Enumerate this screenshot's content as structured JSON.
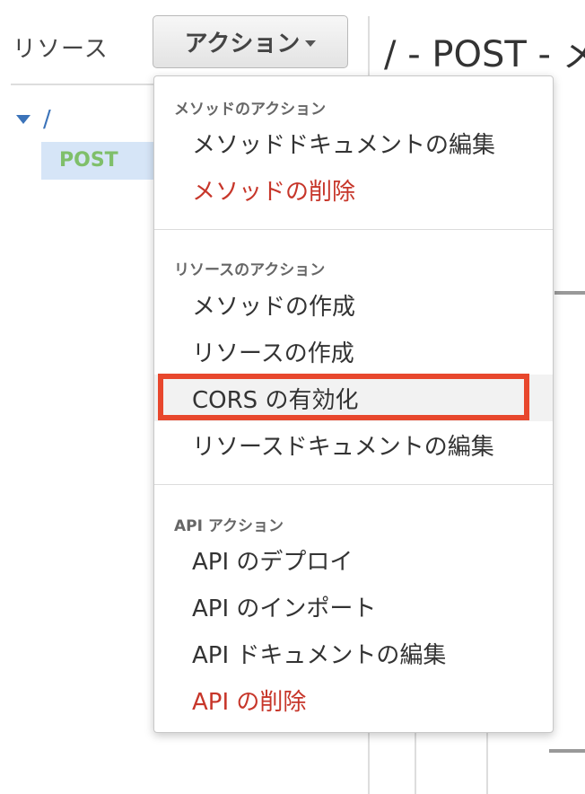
{
  "resources_panel": {
    "title": "リソース",
    "tree": {
      "root_label": "/",
      "method_label": "POST"
    }
  },
  "actions_button": {
    "label": "アクション"
  },
  "main_panel": {
    "method_title": "/ - POST - メ"
  },
  "dropdown": {
    "sections": [
      {
        "header": "メソッドのアクション",
        "items": [
          {
            "label": "メソッドドキュメントの編集",
            "style": "normal"
          },
          {
            "label": "メソッドの削除",
            "style": "danger"
          }
        ]
      },
      {
        "header": "リソースのアクション",
        "items": [
          {
            "label": "メソッドの作成",
            "style": "normal"
          },
          {
            "label": "リソースの作成",
            "style": "normal"
          },
          {
            "label": "CORS の有効化",
            "style": "highlighted"
          },
          {
            "label": "リソースドキュメントの編集",
            "style": "normal"
          }
        ]
      },
      {
        "header": "API アクション",
        "items": [
          {
            "label": "API のデプロイ",
            "style": "normal"
          },
          {
            "label": "API のインポート",
            "style": "normal"
          },
          {
            "label": "API ドキュメントの編集",
            "style": "normal"
          },
          {
            "label": "API の削除",
            "style": "danger"
          }
        ]
      }
    ]
  },
  "colors": {
    "danger": "#c7362a",
    "highlight_border": "#e8472d",
    "link": "#3b73b9",
    "method_post": "#7fbf6a",
    "selected_row": "#d6e5f7"
  }
}
